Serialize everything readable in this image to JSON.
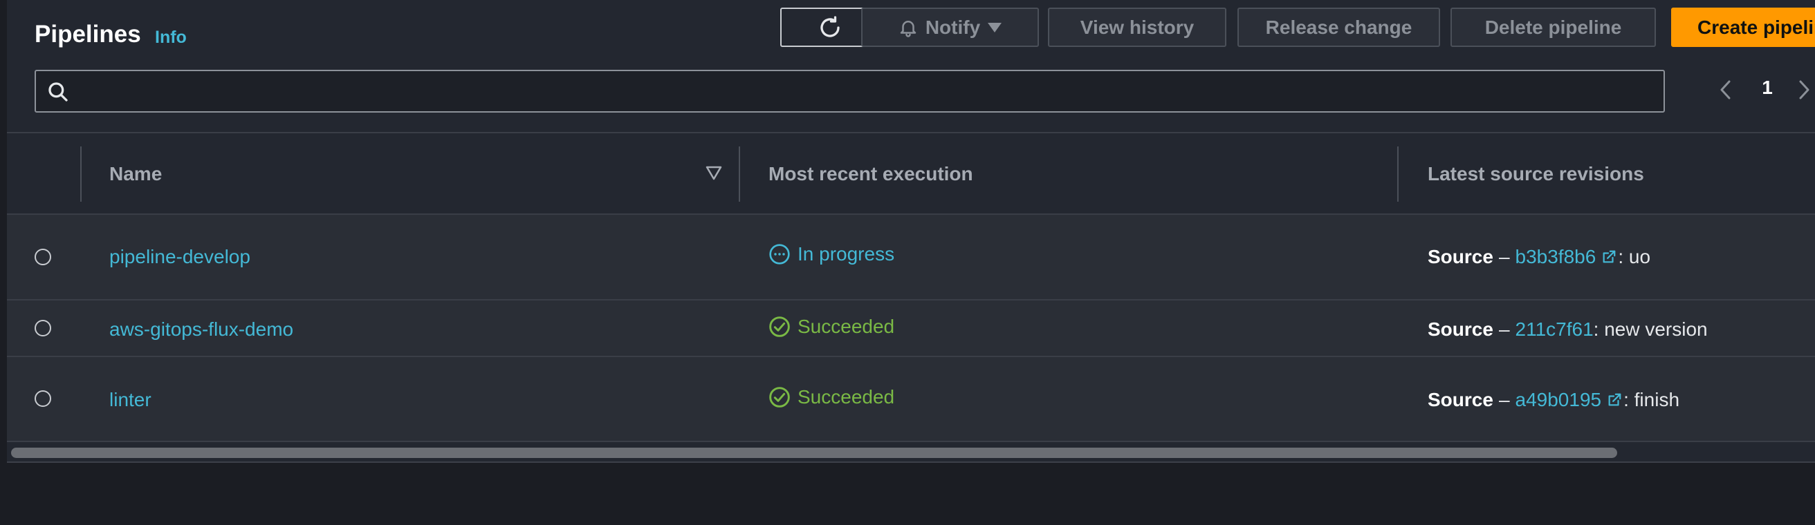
{
  "header": {
    "title": "Pipelines",
    "info_label": "Info"
  },
  "toolbar": {
    "refresh_icon": "refresh-icon",
    "notify_label": "Notify",
    "view_history_label": "View history",
    "release_change_label": "Release change",
    "delete_pipeline_label": "Delete pipeline",
    "create_pipeline_label": "Create pipeline"
  },
  "search": {
    "value": "",
    "placeholder": ""
  },
  "pagination": {
    "current_page": "1"
  },
  "table": {
    "columns": [
      "Name",
      "Most recent execution",
      "Latest source revisions"
    ],
    "rows": [
      {
        "name": "pipeline-develop",
        "status": "In progress",
        "status_type": "in-progress",
        "source_label": "Source",
        "separator": "–",
        "revision": "b3b3f8b6",
        "external_link": true,
        "message": ": uo"
      },
      {
        "name": "aws-gitops-flux-demo",
        "status": "Succeeded",
        "status_type": "succeeded",
        "source_label": "Source",
        "separator": "–",
        "revision": "211c7f61",
        "external_link": false,
        "message": ": new version"
      },
      {
        "name": "linter",
        "status": "Succeeded",
        "status_type": "succeeded",
        "source_label": "Source",
        "separator": "–",
        "revision": "a49b0195",
        "external_link": true,
        "message": ": finish"
      }
    ]
  },
  "colors": {
    "accent_orange": "#ff9900",
    "link_blue": "#44b9d6",
    "success_green": "#7ab945",
    "panel_bg": "#232730",
    "row_bg": "#2a2e36"
  }
}
